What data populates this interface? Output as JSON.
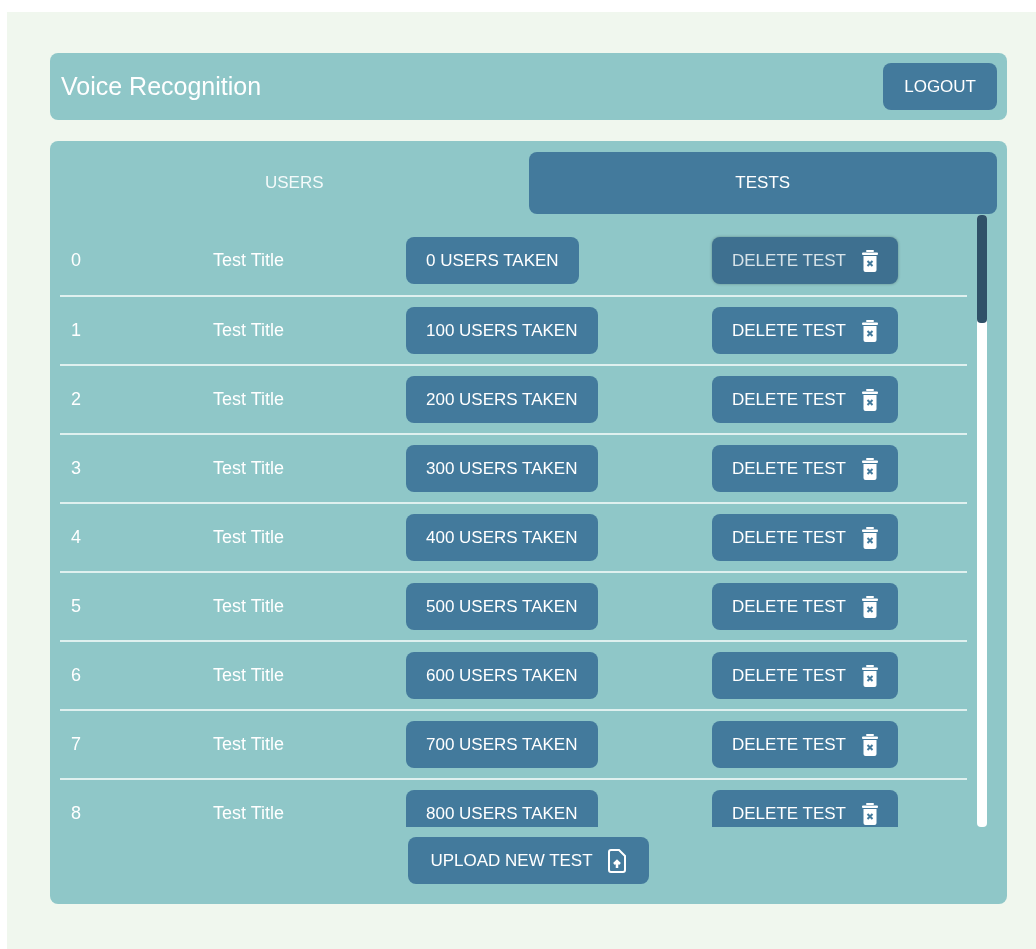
{
  "header": {
    "title": "Voice Recognition",
    "logout": "LOGOUT"
  },
  "tabs": [
    {
      "label": "USERS",
      "selected": false
    },
    {
      "label": "TESTS",
      "selected": true
    }
  ],
  "tests": [
    {
      "index": "0",
      "title": "Test Title",
      "taken": "0 USERS TAKEN",
      "delete": "DELETE TEST",
      "hovered": true
    },
    {
      "index": "1",
      "title": "Test Title",
      "taken": "100 USERS TAKEN",
      "delete": "DELETE TEST",
      "hovered": false
    },
    {
      "index": "2",
      "title": "Test Title",
      "taken": "200 USERS TAKEN",
      "delete": "DELETE TEST",
      "hovered": false
    },
    {
      "index": "3",
      "title": "Test Title",
      "taken": "300 USERS TAKEN",
      "delete": "DELETE TEST",
      "hovered": false
    },
    {
      "index": "4",
      "title": "Test Title",
      "taken": "400 USERS TAKEN",
      "delete": "DELETE TEST",
      "hovered": false
    },
    {
      "index": "5",
      "title": "Test Title",
      "taken": "500 USERS TAKEN",
      "delete": "DELETE TEST",
      "hovered": false
    },
    {
      "index": "6",
      "title": "Test Title",
      "taken": "600 USERS TAKEN",
      "delete": "DELETE TEST",
      "hovered": false
    },
    {
      "index": "7",
      "title": "Test Title",
      "taken": "700 USERS TAKEN",
      "delete": "DELETE TEST",
      "hovered": false
    },
    {
      "index": "8",
      "title": "Test Title",
      "taken": "800 USERS TAKEN",
      "delete": "DELETE TEST",
      "hovered": false
    }
  ],
  "upload": "UPLOAD NEW TEST"
}
